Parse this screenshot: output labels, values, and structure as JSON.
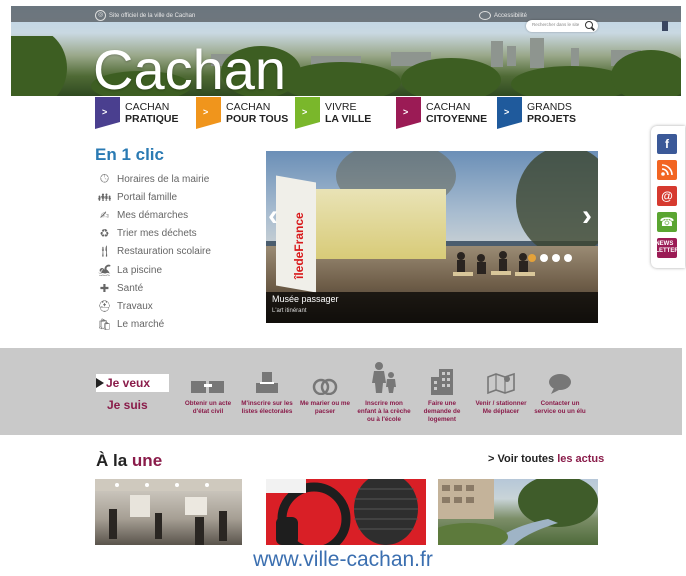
{
  "header": {
    "official_text": "Site officiel de la ville de Cachan",
    "accessibility_label": "Accessibilité",
    "search_placeholder": "Rechercher dans le site",
    "logo_text": "Cachan"
  },
  "nav": {
    "items": [
      {
        "line1": "CACHAN",
        "line2": "PRATIQUE",
        "color": "#4a3f8f"
      },
      {
        "line1": "CACHAN",
        "line2": "POUR TOUS",
        "color": "#f0951c"
      },
      {
        "line1": "VIVRE",
        "line2": "LA VILLE",
        "color": "#7ab72b"
      },
      {
        "line1": "CACHAN",
        "line2": "CITOYENNE",
        "color": "#9b1b55"
      },
      {
        "line1": "GRANDS",
        "line2": "PROJETS",
        "color": "#1f5a9c"
      }
    ],
    "arrow": ">"
  },
  "quick_links": {
    "title": "En 1 clic",
    "items": [
      {
        "label": "Horaires de la mairie",
        "icon": "clock-icon"
      },
      {
        "label": "Portail famille",
        "icon": "family-icon"
      },
      {
        "label": "Mes démarches",
        "icon": "paperwork-icon"
      },
      {
        "label": "Trier mes déchets",
        "icon": "recycle-icon"
      },
      {
        "label": "Restauration scolaire",
        "icon": "fork-knife-icon"
      },
      {
        "label": "La piscine",
        "icon": "swimmer-icon"
      },
      {
        "label": "Santé",
        "icon": "health-cross-icon"
      },
      {
        "label": "Travaux",
        "icon": "worker-icon"
      },
      {
        "label": "Le marché",
        "icon": "shopping-bag-icon"
      }
    ]
  },
  "slideshow": {
    "caption_title": "Musée passager",
    "caption_subtitle": "L'art itinérant",
    "sign_text": "îledeFrance",
    "prev": "‹",
    "next": "›",
    "dot_count": 4,
    "active_dot": 0
  },
  "social": [
    {
      "label": "f",
      "icon": "facebook-icon",
      "color": "#3b5998"
    },
    {
      "label": "rss",
      "icon": "rss-icon",
      "color": "#f26522"
    },
    {
      "label": "@",
      "icon": "email-icon",
      "color": "#d63a2f"
    },
    {
      "label": "☎",
      "icon": "phone-icon",
      "color": "#5aa531"
    },
    {
      "label": "NEWS LETTER",
      "icon": "newsletter-icon",
      "color": "#9b1b55"
    }
  ],
  "quick_actions": {
    "je_veux": "Je veux",
    "je_suis": "Je suis",
    "items": [
      {
        "label": "Obtenir un acte d'état civil",
        "icon": "documents-icon"
      },
      {
        "label": "M'inscrire sur les listes électorales",
        "icon": "ballot-box-icon"
      },
      {
        "label": "Me marier ou me pacser",
        "icon": "rings-icon"
      },
      {
        "label": "Inscrire mon enfant à la crèche ou à l'école",
        "icon": "parent-child-icon"
      },
      {
        "label": "Faire une demande de logement",
        "icon": "building-icon"
      },
      {
        "label": "Venir / stationner Me déplacer",
        "icon": "map-icon"
      },
      {
        "label": "Contacter un service ou un élu",
        "icon": "speech-bubble-icon"
      }
    ]
  },
  "news": {
    "title_a": "À la",
    "title_b": "une",
    "see_all_a": "> Voir toutes",
    "see_all_b": "les actus"
  },
  "footer_url": "www.ville-cachan.fr"
}
